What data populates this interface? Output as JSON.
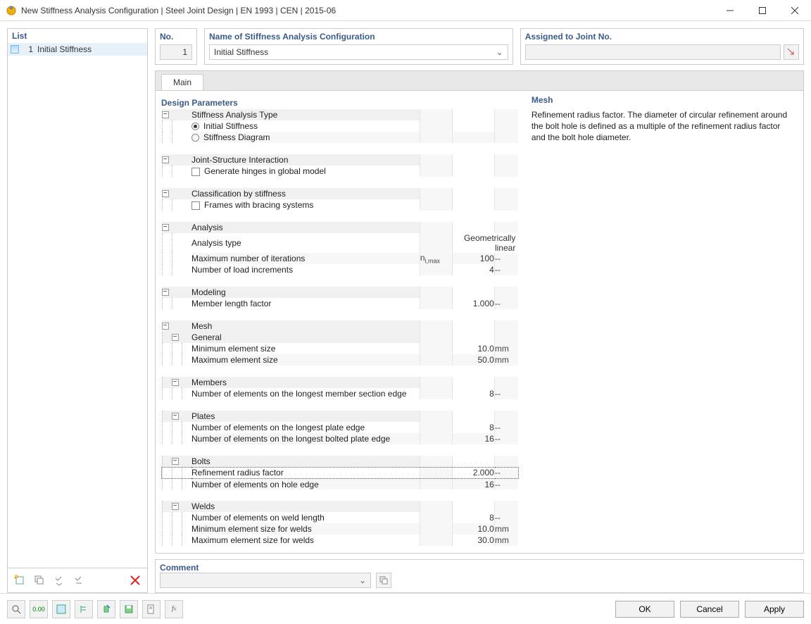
{
  "window": {
    "title": "New Stiffness Analysis Configuration | Steel Joint Design | EN 1993 | CEN | 2015-06"
  },
  "left": {
    "header": "List",
    "items": [
      {
        "num": "1",
        "name": "Initial Stiffness"
      }
    ]
  },
  "top": {
    "no_label": "No.",
    "no_value": "1",
    "name_label": "Name of Stiffness Analysis Configuration",
    "name_value": "Initial Stiffness",
    "assign_label": "Assigned to Joint No."
  },
  "tabs": {
    "main": "Main"
  },
  "sections": {
    "design_parameters": "Design Parameters",
    "stiffness_type": "Stiffness Analysis Type",
    "opt_initial": "Initial Stiffness",
    "opt_diagram": "Stiffness Diagram",
    "joint_struct": "Joint-Structure Interaction",
    "gen_hinges": "Generate hinges in global model",
    "classification": "Classification by stiffness",
    "frames_bracing": "Frames with bracing systems",
    "analysis": "Analysis",
    "analysis_type": "Analysis type",
    "analysis_type_val": "Geometrically linear",
    "max_iter": "Maximum number of iterations",
    "max_iter_sym": "n",
    "max_iter_sub": "i,max",
    "max_iter_val": "100",
    "load_incr": "Number of load increments",
    "load_incr_val": "4",
    "modeling": "Modeling",
    "member_len": "Member length factor",
    "member_len_val": "1.000",
    "mesh": "Mesh",
    "general": "General",
    "min_elem": "Minimum element size",
    "min_elem_val": "10.0",
    "max_elem": "Maximum element size",
    "max_elem_val": "50.0",
    "members": "Members",
    "mem_longest": "Number of elements on the longest member section edge",
    "mem_longest_val": "8",
    "plates": "Plates",
    "plate_longest": "Number of elements on the longest plate edge",
    "plate_longest_val": "8",
    "plate_bolted": "Number of elements on the longest bolted plate edge",
    "plate_bolted_val": "16",
    "bolts": "Bolts",
    "refine": "Refinement radius factor",
    "refine_val": "2.000",
    "hole_edge": "Number of elements on hole edge",
    "hole_edge_val": "16",
    "welds": "Welds",
    "weld_len": "Number of elements on weld length",
    "weld_len_val": "8",
    "weld_min": "Minimum element size for welds",
    "weld_min_val": "10.0",
    "weld_max": "Maximum element size for welds",
    "weld_max_val": "30.0",
    "unit_mm": "mm",
    "unit_dash": "--"
  },
  "help": {
    "title": "Mesh",
    "text": "Refinement radius factor. The diameter of circular refinement around the bolt hole is defined as a multiple of the refinement radius factor and the bolt hole diameter."
  },
  "comment": {
    "label": "Comment"
  },
  "buttons": {
    "ok": "OK",
    "cancel": "Cancel",
    "apply": "Apply"
  }
}
